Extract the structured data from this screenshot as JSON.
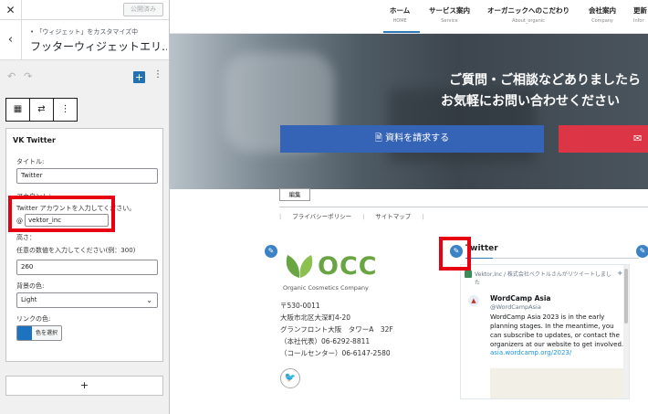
{
  "sidebar": {
    "close_icon": "close-icon",
    "publish_label": "公開済み",
    "header": {
      "subtitle": "• 「ウィジェット」をカスタマイズ中",
      "title": "フッターウィジェットエリ…"
    },
    "widget": {
      "title": "VK Twitter",
      "title_label": "タイトル:",
      "title_value": "Twitter",
      "account_label": "アカウント：",
      "account_hint": "Twitter アカウントを入力してください。",
      "account_at": "@",
      "account_value": "vektor_inc",
      "height_label": "高さ：",
      "height_hint": "任意の数値を入力してください(例：300)",
      "height_value": "260",
      "bg_label": "背景の色:",
      "bg_value": "Light",
      "link_color_label": "リンクの色:",
      "link_color_button": "色を選択",
      "link_color": "#1e73be"
    },
    "add_label": "+"
  },
  "preview": {
    "nav": [
      {
        "label": "ホーム",
        "sub": "HOME"
      },
      {
        "label": "サービス案内",
        "sub": "Service"
      },
      {
        "label": "オーガニックへのこだわり",
        "sub": "About_organic"
      },
      {
        "label": "会社案内",
        "sub": "Company"
      },
      {
        "label": "更新",
        "sub": "Infor"
      }
    ],
    "hero": {
      "line1": "ご質問・ご相談などありましたら",
      "line2": "お気軽にお問い合わせください",
      "doc_button": "資料を請求する",
      "mail_icon": "mail-icon"
    },
    "edit_label": "編集",
    "footer_links": [
      "プライバシーポリシー",
      "サイトマップ"
    ],
    "company": {
      "logo_text": "OCC",
      "tagline": "Organic Cosmetics Company",
      "address": [
        "〒530-0011",
        "大阪市北区大深町4-20",
        "グランフロント大阪　タワーA　32F",
        "（本社代表）06-6292-8811",
        "（コールセンター）06-6147-2580"
      ]
    },
    "twitter": {
      "heading": "Twitter",
      "retweet_note": "Vektor,Inc / 株式会社ベクトルさんがリツイートしました",
      "name": "WordCamp Asia",
      "handle": "@WordCampAsia",
      "text": "WordCamp Asia 2023 is in the early planning stages. In the meantime, you can subscribe to updates, or contact the organizers at our website to get involved.",
      "link": "asia.wordcamp.org/2023/"
    }
  },
  "colors": {
    "accent": "#2271b1",
    "highlight": "#e60012",
    "brand_green": "#6aa544",
    "doc_button": "#3563b5",
    "mail_button": "#dc3545"
  }
}
